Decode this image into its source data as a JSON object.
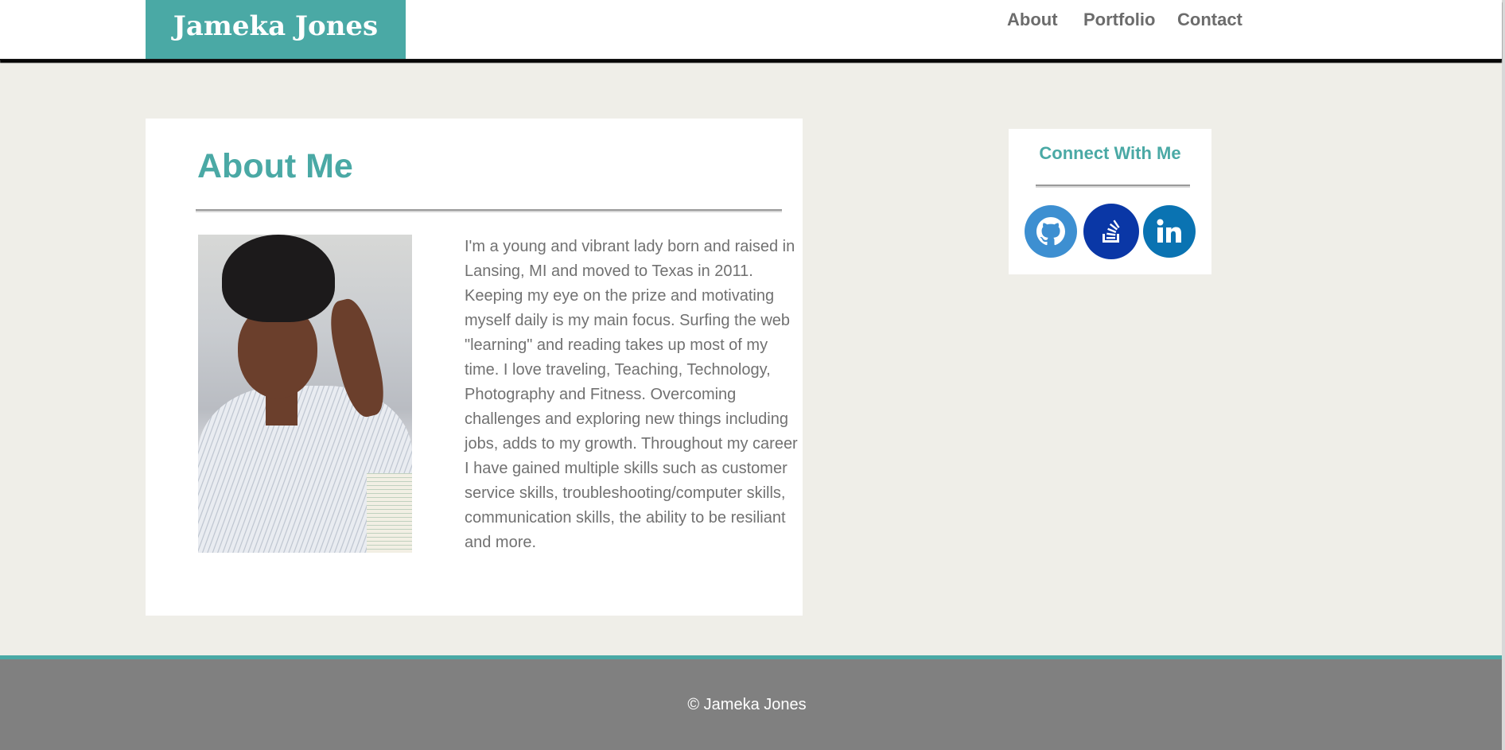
{
  "header": {
    "brand": "Jameka Jones",
    "nav": [
      {
        "label": "About"
      },
      {
        "label": "Portfolio"
      },
      {
        "label": "Contact"
      }
    ]
  },
  "about": {
    "title": "About Me",
    "photo_description": "portrait photo",
    "text": "I'm a young and vibrant lady born and raised in Lansing, MI and moved to Texas in 2011. Keeping my eye on the prize and motivating myself daily is my main focus. Surfing the web \"learning\" and reading takes up most of my time. I love traveling, Teaching, Technology, Photography and Fitness. Overcoming challenges and exploring new things including jobs, adds to my growth. Throughout my career I have gained multiple skills such as customer service skills, troubleshooting/computer skills, communication skills, the ability to be resiliant and more."
  },
  "connect": {
    "title": "Connect With Me",
    "links": [
      {
        "icon": "github-icon",
        "color": "#3d8fd1"
      },
      {
        "icon": "stackoverflow-icon",
        "color": "#0a37a6"
      },
      {
        "icon": "linkedin-icon",
        "color": "#0a73b2"
      }
    ]
  },
  "footer": {
    "copyright": "© Jameka Jones"
  },
  "colors": {
    "accent": "#4aa9a5",
    "page_bg": "#efeee8",
    "text": "#717171",
    "footer_bg": "#808080"
  }
}
